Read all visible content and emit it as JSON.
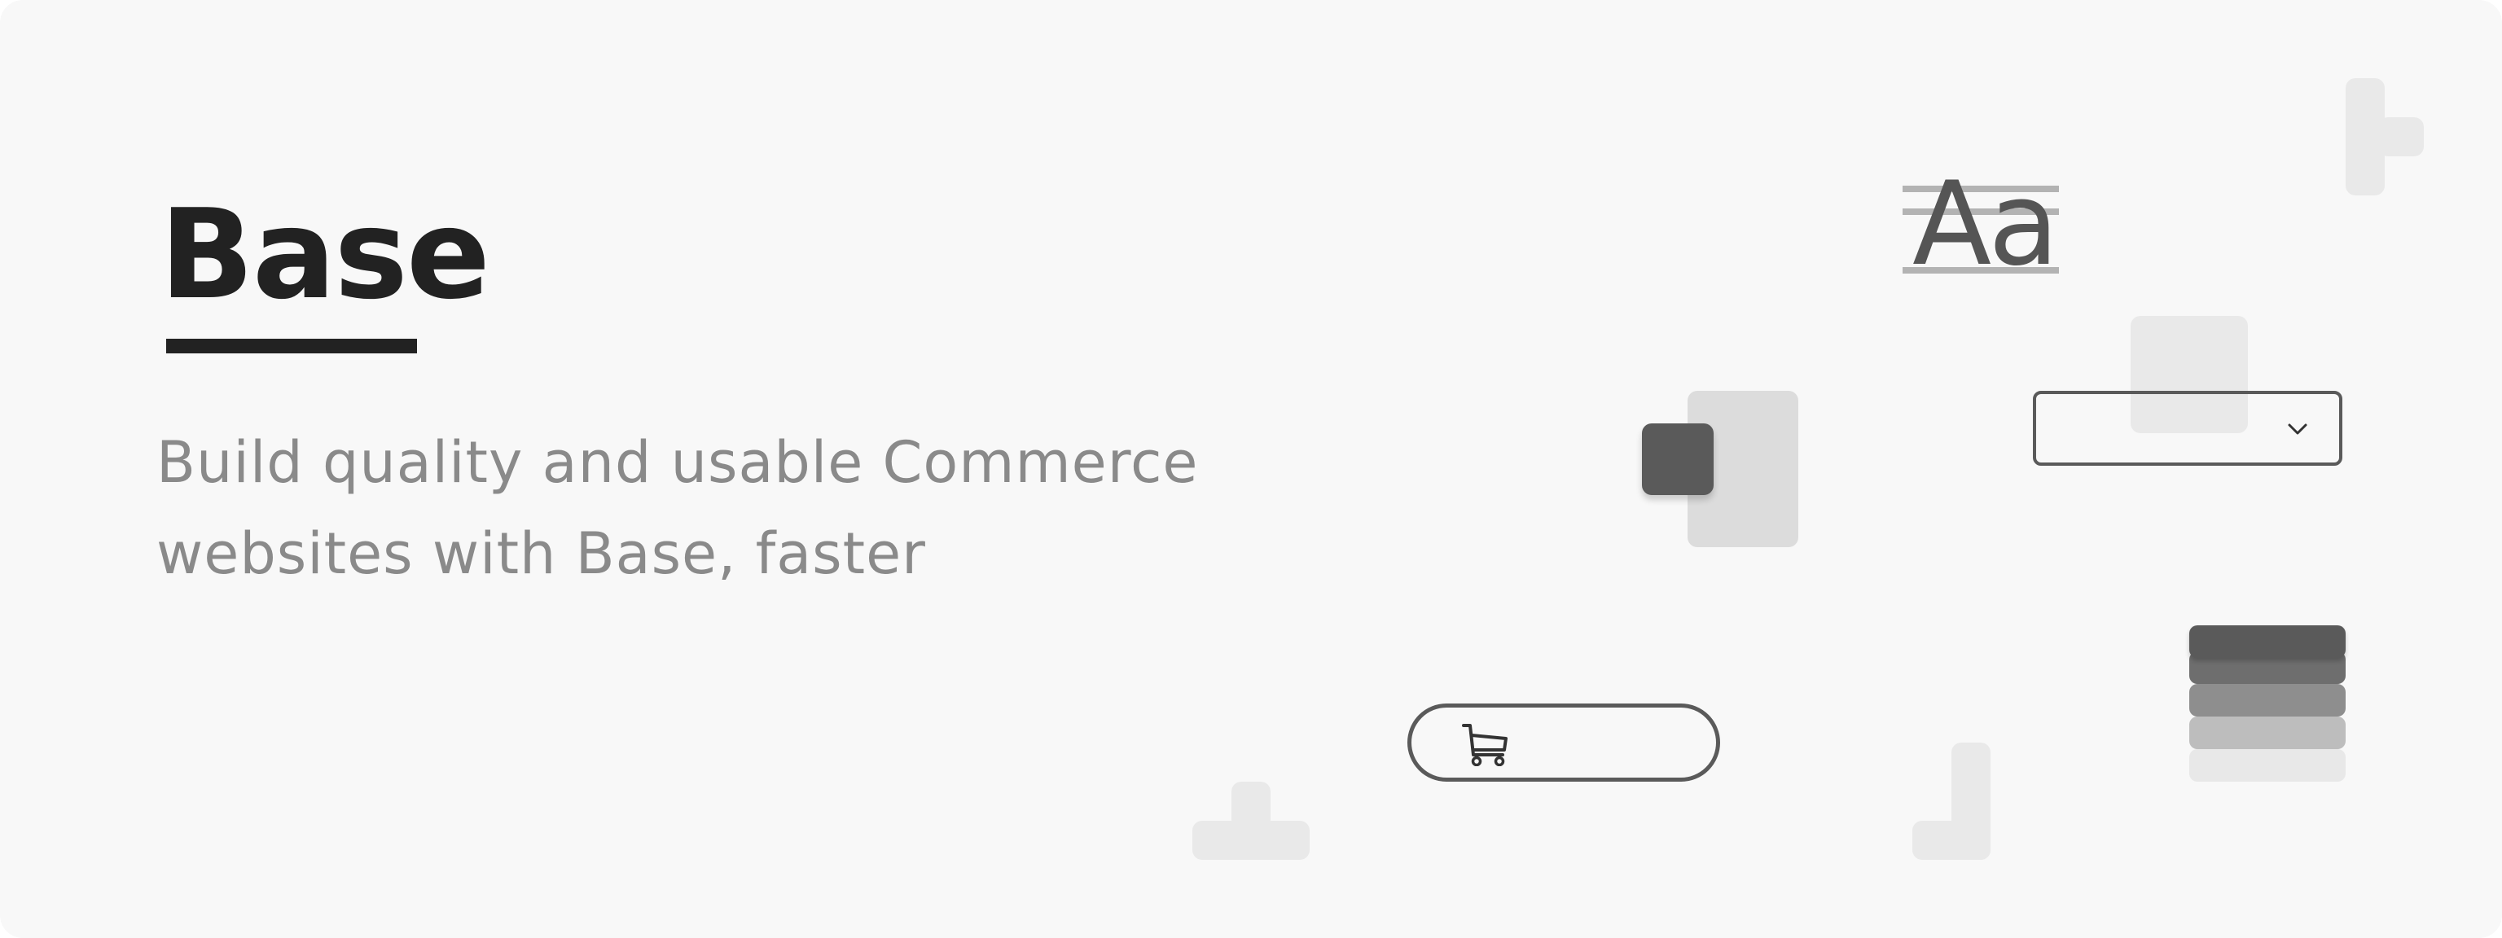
{
  "brand": {
    "title": "Base"
  },
  "tagline": {
    "line1": "Build quality and usable Commerce",
    "line2": "websites with Base, faster"
  },
  "typography_sample": {
    "glyph": "Aa"
  },
  "icons": {
    "cart": "cart-icon",
    "dropdown": "chevron-down-icon"
  },
  "colors": {
    "background": "#f8f8f8",
    "title": "#222222",
    "tagline": "#8a8a8a",
    "ui_outline": "#5a5a5a",
    "light_shape": "#e9e9e9"
  }
}
